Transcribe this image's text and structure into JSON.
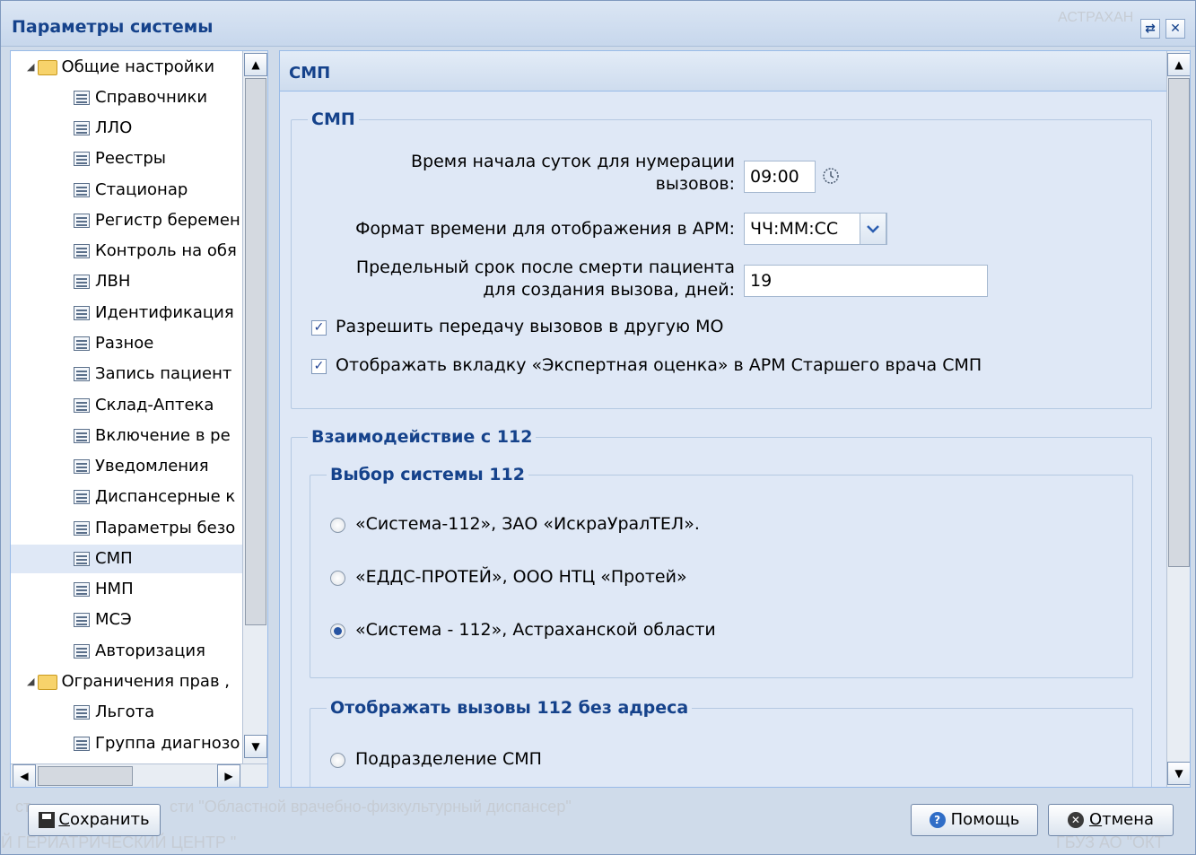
{
  "window": {
    "title": "Параметры системы",
    "ghost_top_right": "АСТРАХАН",
    "ghost_bottom_line1": "сти \"Областной врачебно-физкультурный диспансер\"",
    "ghost_bottom_line1_left": "ст",
    "ghost_bottom_line2": "Й ГЕРИАТРИЧЕСКИЙ ЦЕНТР \"",
    "ghost_bottom_right": "ГБУЗ АО \"ОКТ"
  },
  "tree": {
    "groups": [
      {
        "label": "Общие настройки"
      },
      {
        "label": "Ограничения прав ,"
      }
    ],
    "items": [
      {
        "label": "Справочники"
      },
      {
        "label": "ЛЛО"
      },
      {
        "label": "Реестры"
      },
      {
        "label": "Стационар"
      },
      {
        "label": "Регистр беремен"
      },
      {
        "label": "Контроль на обя"
      },
      {
        "label": "ЛВН"
      },
      {
        "label": "Идентификация"
      },
      {
        "label": "Разное"
      },
      {
        "label": "Запись пациент"
      },
      {
        "label": "Склад-Аптека"
      },
      {
        "label": "Включение в ре"
      },
      {
        "label": "Уведомления"
      },
      {
        "label": "Диспансерные к"
      },
      {
        "label": "Параметры безо"
      },
      {
        "label": "СМП"
      },
      {
        "label": "НМП"
      },
      {
        "label": "МСЭ"
      },
      {
        "label": "Авторизация"
      },
      {
        "label": "Льгота"
      },
      {
        "label": "Группа диагнозо"
      }
    ],
    "selected": "СМП"
  },
  "panel": {
    "header": "СМП",
    "smp_fieldset": {
      "legend": "СМП",
      "start_time_label_1": "Время начала суток для нумерации",
      "start_time_label_2": "вызовов:",
      "start_time_value": "09:00",
      "time_format_label": "Формат времени для отображения в АРМ:",
      "time_format_value": "ЧЧ:ММ:СС",
      "death_limit_label_1": "Предельный срок после смерти пациента",
      "death_limit_label_2": "для создания вызова, дней:",
      "death_limit_value": "19",
      "allow_transfer_label": "Разрешить передачу вызовов в другую МО",
      "allow_transfer_checked": true,
      "show_expert_label": "Отображать вкладку «Экспертная оценка» в АРМ Старшего врача СМП",
      "show_expert_checked": true
    },
    "interaction_fieldset": {
      "legend": "Взаимодействие с 112",
      "system_choice": {
        "legend": "Выбор системы 112",
        "options": [
          {
            "label": "«Система-112», ЗАО «ИскраУралТЕЛ».",
            "selected": false
          },
          {
            "label": "«ЕДДС-ПРОТЕЙ», ООО НТЦ «Протей»",
            "selected": false
          },
          {
            "label": "«Система - 112», Астраханской области",
            "selected": true
          }
        ]
      },
      "no_address": {
        "legend": "Отображать вызовы 112 без адреса",
        "options": [
          {
            "label": "Подразделение СМП",
            "selected": false
          }
        ]
      }
    }
  },
  "buttons": {
    "save_prefix": "С",
    "save_rest": "охранить",
    "help": "Помощь",
    "cancel_prefix": "О",
    "cancel_rest": "тмена"
  },
  "colors": {
    "accent": "#15428b",
    "panel_bg": "#dfe8f6",
    "window_bg": "#cfdbea",
    "selected_row": "#dfe8f6",
    "help_icon": "#2f6dc7",
    "cancel_icon": "#3a3a3a"
  }
}
